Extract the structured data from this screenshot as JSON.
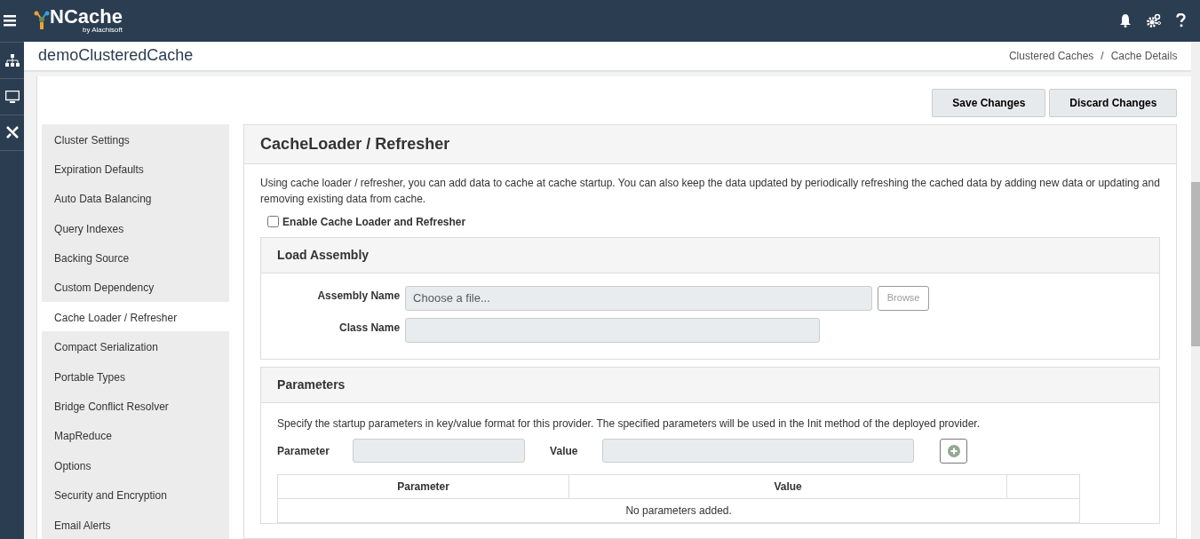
{
  "app": {
    "logo_text": "NCache",
    "logo_sub": "by Alachisoft"
  },
  "header": {
    "title": "demoClusteredCache",
    "breadcrumb": [
      "Clustered Caches",
      "Cache Details"
    ],
    "breadcrumb_separator": "/"
  },
  "actions": [
    "Save Changes",
    "Discard Changes"
  ],
  "sidebar": {
    "items": [
      {
        "label": "Cluster Settings",
        "selected": false
      },
      {
        "label": "Expiration Defaults",
        "selected": false
      },
      {
        "label": "Auto Data Balancing",
        "selected": false
      },
      {
        "label": "Query Indexes",
        "selected": false
      },
      {
        "label": "Backing Source",
        "selected": false
      },
      {
        "label": "Custom Dependency",
        "selected": false
      },
      {
        "label": "Cache Loader / Refresher",
        "selected": true
      },
      {
        "label": "Compact Serialization",
        "selected": false
      },
      {
        "label": "Portable Types",
        "selected": false
      },
      {
        "label": "Bridge Conflict Resolver",
        "selected": false
      },
      {
        "label": "MapReduce",
        "selected": false
      },
      {
        "label": "Options",
        "selected": false
      },
      {
        "label": "Security and Encryption",
        "selected": false
      },
      {
        "label": "Email Alerts",
        "selected": false
      }
    ]
  },
  "panel": {
    "title": "CacheLoader / Refresher",
    "description": "Using cache loader / refresher, you can add data to cache at cache startup. You can also keep the data updated by periodically refreshing the cached data by adding new data or updating and removing existing data from cache.",
    "enable": {
      "label": "Enable Cache Loader and Refresher",
      "checked": false
    },
    "load_assembly": {
      "title": "Load Assembly",
      "assembly_label": "Assembly Name",
      "assembly_placeholder": "Choose a file...",
      "browse": "Browse",
      "class_label": "Class Name",
      "disabled": true
    },
    "parameters": {
      "title": "Parameters",
      "description": "Specify the startup parameters in key/value format for this provider. The specified parameters will be used in the Init method of the deployed provider.",
      "parameter_label": "Parameter",
      "value_label": "Value",
      "disabled": true,
      "table": {
        "columns": [
          "Parameter",
          "Value"
        ],
        "empty": "No parameters added."
      }
    }
  }
}
